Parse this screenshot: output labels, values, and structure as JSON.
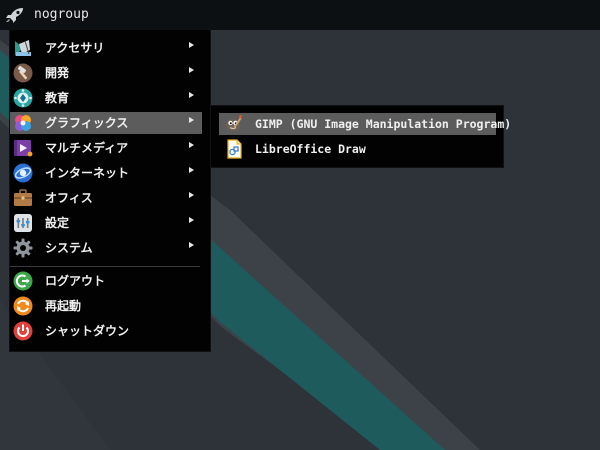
{
  "panel": {
    "launcher_label": "nogroup"
  },
  "menu": {
    "items": [
      {
        "label": "アクセサリ",
        "icon": "accessories-icon",
        "has_submenu": true
      },
      {
        "label": "開発",
        "icon": "development-hammer-icon",
        "has_submenu": true
      },
      {
        "label": "教育",
        "icon": "education-icon",
        "has_submenu": true
      },
      {
        "label": "グラフィックス",
        "icon": "graphics-icon",
        "has_submenu": true,
        "active": true
      },
      {
        "label": "マルチメディア",
        "icon": "multimedia-icon",
        "has_submenu": true
      },
      {
        "label": "インターネット",
        "icon": "internet-globe-icon",
        "has_submenu": true
      },
      {
        "label": "オフィス",
        "icon": "office-briefcase-icon",
        "has_submenu": true
      },
      {
        "label": "設定",
        "icon": "settings-icon",
        "has_submenu": true
      },
      {
        "label": "システム",
        "icon": "system-gear-icon",
        "has_submenu": true
      }
    ],
    "session": [
      {
        "label": "ログアウト",
        "icon": "logout-icon"
      },
      {
        "label": "再起動",
        "icon": "restart-icon"
      },
      {
        "label": "シャットダウン",
        "icon": "shutdown-icon"
      }
    ]
  },
  "submenu": {
    "items": [
      {
        "label": "GIMP (GNU Image Manipulation Program)",
        "icon": "gimp-icon",
        "active": true
      },
      {
        "label": "LibreOffice Draw",
        "icon": "libreoffice-draw-icon"
      }
    ]
  },
  "colors": {
    "desktop_bg": "#2c3237",
    "teal_stripe": "#1f5e5f",
    "panel_bg": "#0d1013",
    "menu_bg": "#020202",
    "highlight": "#5c5c5c"
  }
}
